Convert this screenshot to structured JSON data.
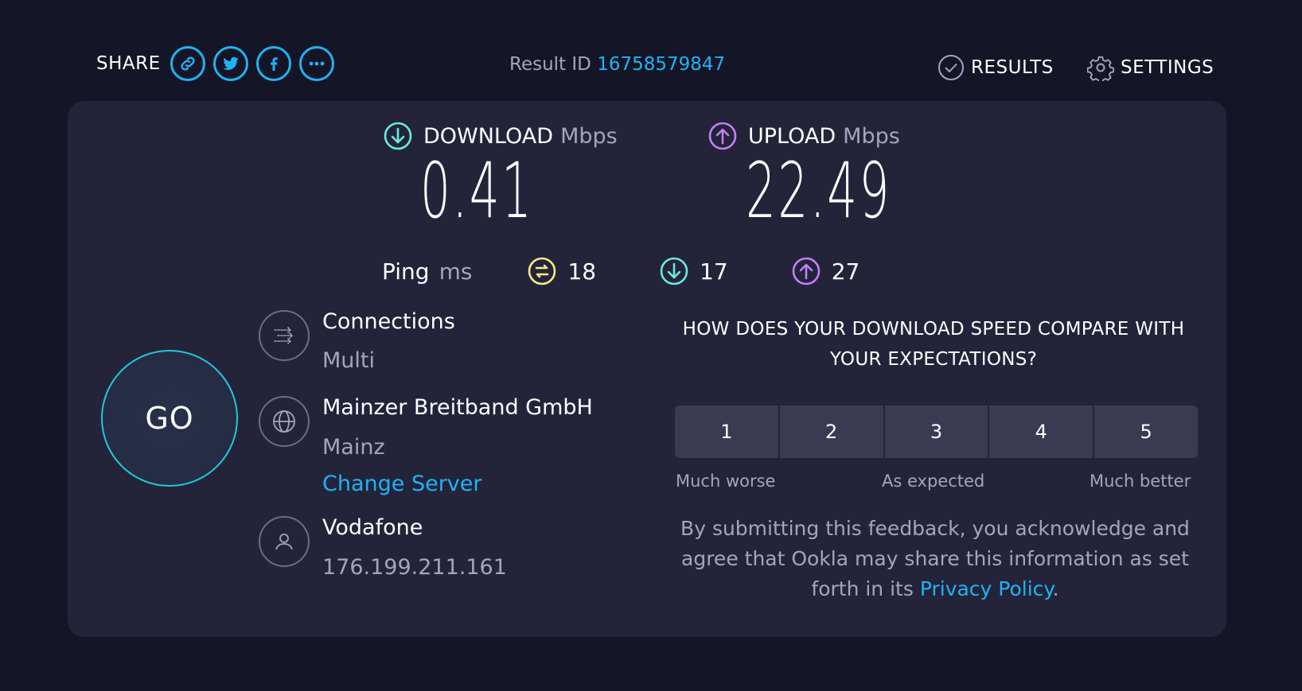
{
  "share": {
    "label": "SHARE",
    "buttons": [
      "link-icon",
      "twitter-icon",
      "facebook-icon",
      "more-icon"
    ]
  },
  "result": {
    "label": "Result ID",
    "id": "16758579847"
  },
  "nav": {
    "results": "RESULTS",
    "settings": "SETTINGS"
  },
  "download": {
    "label": "DOWNLOAD",
    "unit": "Mbps",
    "value": "0.41"
  },
  "upload": {
    "label": "UPLOAD",
    "unit": "Mbps",
    "value": "22.49"
  },
  "ping": {
    "label": "Ping",
    "unit": "ms",
    "idle": "18",
    "download": "17",
    "upload": "27"
  },
  "go": {
    "label": "GO"
  },
  "connections": {
    "title": "Connections",
    "value": "Multi"
  },
  "server": {
    "name": "Mainzer Breitband GmbH",
    "location": "Mainz",
    "change": "Change Server"
  },
  "provider": {
    "name": "Vodafone",
    "ip": "176.199.211.161"
  },
  "survey": {
    "question": "HOW DOES YOUR DOWNLOAD SPEED COMPARE WITH YOUR EXPECTATIONS?",
    "options": [
      "1",
      "2",
      "3",
      "4",
      "5"
    ],
    "low": "Much worse",
    "mid": "As expected",
    "high": "Much better",
    "disclaimer_pre": "By submitting this feedback, you acknowledge and agree that Ookla may share this information as set forth in its ",
    "policy": "Privacy Policy",
    "disclaimer_post": "."
  },
  "colors": {
    "background": "#141526",
    "panel": "#23243a",
    "accent_blue": "#1fb3f4",
    "download_cyan": "#6ce9e0",
    "upload_purple": "#c37ef7",
    "ping_yellow": "#fde98a",
    "go_ring": "#23c7d5"
  }
}
